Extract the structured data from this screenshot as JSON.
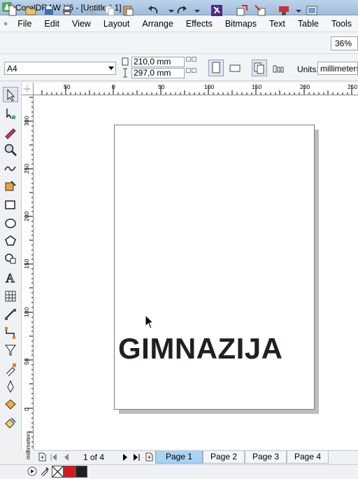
{
  "window": {
    "title": "CorelDRAW X6 - [Untitled-1]"
  },
  "menu": [
    "File",
    "Edit",
    "View",
    "Layout",
    "Arrange",
    "Effects",
    "Bitmaps",
    "Text",
    "Table",
    "Tools"
  ],
  "toolbar": {
    "zoom": "36%"
  },
  "property_bar": {
    "page_size": "A4",
    "width": "210,0 mm",
    "height": "297,0 mm",
    "units_label": "Units:",
    "units_value": "millimeters"
  },
  "rulers": {
    "horizontal_labels": [
      "50",
      "0",
      "50",
      "100",
      "150",
      "200",
      "250"
    ],
    "vertical_labels": [
      "300",
      "250",
      "200",
      "150",
      "100",
      "50",
      "0"
    ],
    "unit": "millimeters"
  },
  "document": {
    "text": "GIMNAZIJA"
  },
  "navigator": {
    "page_count": "1 of 4",
    "tabs": [
      "Page 1",
      "Page 2",
      "Page 3",
      "Page 4"
    ],
    "active_tab": "Page 1"
  },
  "palette": {
    "colors": [
      "#e3141c",
      "#231f20"
    ]
  },
  "icons": {
    "toolbox": [
      "pick-tool",
      "shape-tool",
      "smear-tool",
      "zoom-tool",
      "freehand-tool",
      "smart-fill-tool",
      "rectangle-tool",
      "ellipse-tool",
      "polygon-tool",
      "basic-shapes-tool",
      "text-tool",
      "table-tool",
      "parallel-dimension-tool",
      "straight-line-connector-tool",
      "blend-tool",
      "color-eyedropper-tool",
      "outline-pen-tool",
      "fill-tool",
      "interactive-fill-tool"
    ]
  }
}
